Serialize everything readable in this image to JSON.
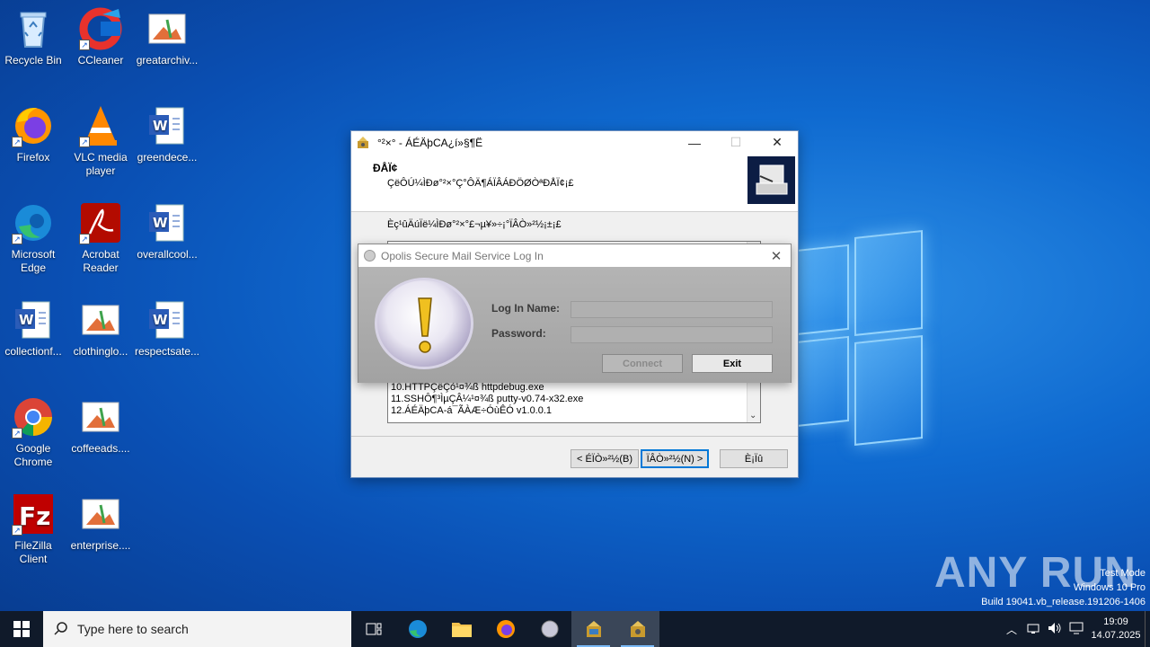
{
  "desktop": {
    "icons": [
      {
        "label": "Recycle Bin",
        "icon": "recycle-bin-icon"
      },
      {
        "label": "CCleaner",
        "icon": "ccleaner-icon"
      },
      {
        "label": "greatarchiv...",
        "icon": "image-file-icon"
      },
      {
        "label": "Firefox",
        "icon": "firefox-icon"
      },
      {
        "label": "VLC media player",
        "icon": "vlc-icon"
      },
      {
        "label": "greendece...",
        "icon": "word-doc-icon"
      },
      {
        "label": "Microsoft Edge",
        "icon": "edge-icon"
      },
      {
        "label": "Acrobat Reader",
        "icon": "acrobat-icon"
      },
      {
        "label": "overallcool...",
        "icon": "word-doc-icon"
      },
      {
        "label": "collectionf...",
        "icon": "word-doc-icon"
      },
      {
        "label": "clothinglo...",
        "icon": "image-file-icon"
      },
      {
        "label": "respectsate...",
        "icon": "word-doc-icon"
      },
      {
        "label": "Google Chrome",
        "icon": "chrome-icon"
      },
      {
        "label": "coffeeads....",
        "icon": "image-file-icon"
      },
      {
        "label": "FileZilla Client",
        "icon": "filezilla-icon"
      },
      {
        "label": "enterprise....",
        "icon": "image-file-icon"
      }
    ]
  },
  "installer": {
    "title": "°²×° - ÁÉÄþCA¿í»§¶Ë",
    "header_title": "ÐÅÏ¢",
    "header_subtitle": "ÇëÔÚ¼ÌÐø°²×°Ç°ÔÄ¶ÁÏÂÁÐÖØÒªÐÅÏ¢¡£",
    "body_text": "Èç¹ûÄúÏë¼ÌÐø°²×°£¬µ¥»÷¡°ÏÂÒ»²½¡±¡£",
    "list_items": [
      "10.HTTPÇëÇó¹¤¾ß httpdebug.exe",
      "11.SSHÔ¶³ÌµÇÂ¼¹¤¾ß putty-v0.74-x32.exe",
      "12.ÁÉÄþCA-á¯ÃÀÆ÷ÓùÊÓ v1.0.0.1"
    ],
    "btn_back": "< ÉÏÒ»²½(B)",
    "btn_next": "ÏÂÒ»²½(N) >",
    "btn_cancel": "È¡Ïû"
  },
  "login_dialog": {
    "title": "Opolis Secure Mail Service Log In",
    "login_label": "Log In Name:",
    "password_label": "Password:",
    "login_value": "",
    "password_value": "",
    "connect_label": "Connect",
    "exit_label": "Exit"
  },
  "taskbar": {
    "search_placeholder": "Type here to search",
    "time": "19:09",
    "date": "14.07.2025"
  },
  "watermark": {
    "brand": "ANY RUN",
    "line1": "Test Mode",
    "line2": "Windows 10 Pro",
    "line3": "Build 19041.vb_release.191206-1406"
  }
}
